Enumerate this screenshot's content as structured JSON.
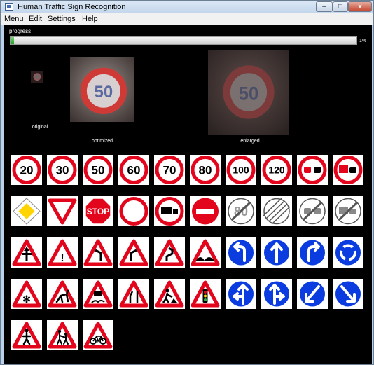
{
  "window": {
    "title": "Human Traffic Sign Recognition",
    "minimize": "–",
    "maximize": "□",
    "close": "x"
  },
  "menu": [
    "Menu",
    "Edit",
    "Settings",
    "Help"
  ],
  "progress": {
    "label": "progress",
    "value_text": "1%",
    "fraction": 0.01
  },
  "previews": {
    "original": "original",
    "optimized": "optimized",
    "enlarged": "enlarged",
    "sign_text": "50"
  },
  "signs": [
    {
      "kind": "speed",
      "text": "20"
    },
    {
      "kind": "speed",
      "text": "30"
    },
    {
      "kind": "speed",
      "text": "50"
    },
    {
      "kind": "speed",
      "text": "60"
    },
    {
      "kind": "speed",
      "text": "70"
    },
    {
      "kind": "speed",
      "text": "80"
    },
    {
      "kind": "speed",
      "text": "100"
    },
    {
      "kind": "speed",
      "text": "120"
    },
    {
      "kind": "no-overtaking"
    },
    {
      "kind": "no-overtaking-trucks"
    },
    {
      "kind": "priority-road"
    },
    {
      "kind": "yield"
    },
    {
      "kind": "stop",
      "text": "STOP"
    },
    {
      "kind": "no-vehicles"
    },
    {
      "kind": "no-trucks"
    },
    {
      "kind": "no-entry"
    },
    {
      "kind": "end-speed",
      "text": "80"
    },
    {
      "kind": "end-restrictions"
    },
    {
      "kind": "end-no-overtaking"
    },
    {
      "kind": "end-no-overtaking-trucks"
    },
    {
      "kind": "warn-right-of-way"
    },
    {
      "kind": "warn-general",
      "text": "!"
    },
    {
      "kind": "warn-curve-left"
    },
    {
      "kind": "warn-curve-right"
    },
    {
      "kind": "warn-double-curve"
    },
    {
      "kind": "warn-bumpy-road"
    },
    {
      "kind": "turn-left"
    },
    {
      "kind": "ahead-only"
    },
    {
      "kind": "turn-right"
    },
    {
      "kind": "roundabout"
    },
    {
      "kind": "warn-snow",
      "text": "✻"
    },
    {
      "kind": "warn-animals"
    },
    {
      "kind": "warn-slippery"
    },
    {
      "kind": "warn-road-narrows"
    },
    {
      "kind": "warn-road-work"
    },
    {
      "kind": "warn-traffic-signals"
    },
    {
      "kind": "straight-or-left"
    },
    {
      "kind": "straight-or-right"
    },
    {
      "kind": "keep-left"
    },
    {
      "kind": "keep-right"
    },
    {
      "kind": "warn-pedestrians"
    },
    {
      "kind": "warn-children"
    },
    {
      "kind": "warn-bicycles"
    }
  ],
  "colors": {
    "sign_red": "#e3051b",
    "sign_blue": "#0a3ce0",
    "sign_yellow": "#ffd400",
    "background": "#000000",
    "progress": "#1ea51e"
  }
}
